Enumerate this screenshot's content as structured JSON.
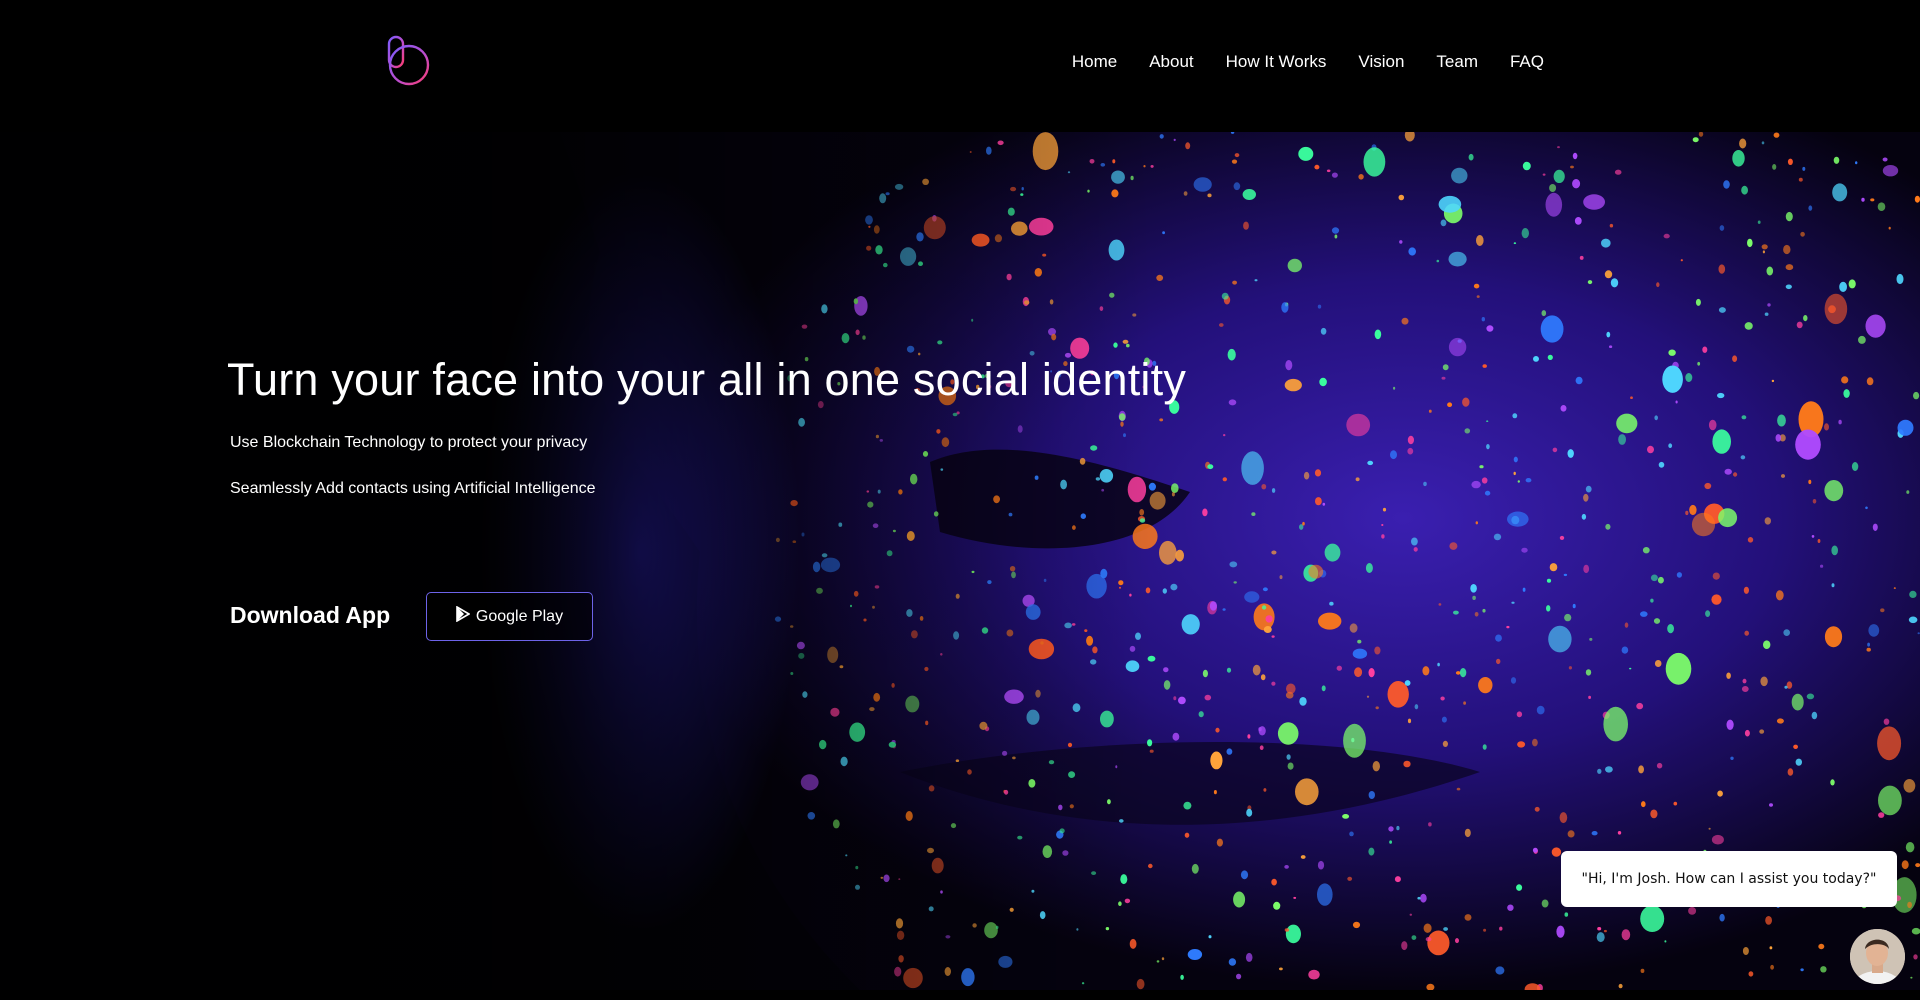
{
  "header": {
    "logo_icon": "brand-logo-icon",
    "nav": [
      {
        "label": "Home"
      },
      {
        "label": "About"
      },
      {
        "label": "How It Works"
      },
      {
        "label": "Vision"
      },
      {
        "label": "Team"
      },
      {
        "label": "FAQ"
      }
    ]
  },
  "hero": {
    "headline": "Turn your face into your all in one social identity",
    "sublines": [
      "Use Blockchain Technology to protect your privacy",
      "Seamlessly Add contacts using Artificial Intelligence"
    ],
    "download_label": "Download App",
    "google_play_label": "Google Play",
    "google_play_icon": "play-triangle-icon",
    "background": "neon-paint-face-image"
  },
  "chat": {
    "greeting": "\"Hi, I'm Josh. How can I assist you today?\"",
    "avatar_icon": "person-avatar-icon"
  },
  "colors": {
    "background": "#000000",
    "button_border": "#6d63e8",
    "logo_gradient_start": "#7b5cff",
    "logo_gradient_end": "#ff3c6e"
  }
}
